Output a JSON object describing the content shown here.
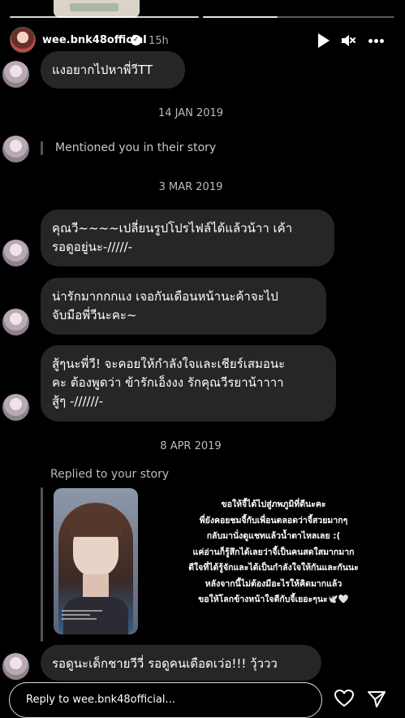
{
  "header": {
    "username": "wee.bnk48official",
    "time": "15h"
  },
  "messages": [
    {
      "text": "แงอยากไปหาพี่วีTT"
    },
    {
      "date": "14 JAN 2019"
    },
    {
      "mention": "Mentioned you in their story"
    },
    {
      "date": "3 MAR 2019"
    },
    {
      "text": "คุณวี~~~~เปลี่ยนรูปโปรไฟล์ได้แล้วน้าา เค้า\nรอดูอยู่นะ-/////-"
    },
    {
      "text": "น่ารักมากกกแง เจอกันเดือนหน้านะค้าจะไป\nจับมือพี่วีนะคะ~"
    },
    {
      "text": "สู้ๆนะพี่วี! จะคอยให้กำลังใจและเชียร์เสมอนะ\nคะ ต้องพูดว่า ข้ารักเอ็งงง รักคุณวีรยาน้าาาา\nสู้ๆ -//////-"
    },
    {
      "date": "8 APR 2019"
    },
    {
      "text": "รอดูนะเด็กชายวีวี่ รอดูคนเดือดเว่อ!!! วุ้ววว"
    }
  ],
  "story_reply": {
    "label": "Replied to your story",
    "text": "ขอให้จี้ได้ไปสู่ภพภูมิที่ดีนะคะ\nพี่ยังคอยชมจี้กับเพื่อนตลอดว่าจี้สวยมากๆ\nกลับมานั่งดูแชทแล้วน้ำตาไหลเลย :(\nแค่อ่านก็รู้สึกได้เลยว่าจี้เป็นคนสดใสมากมาก\nดีใจที่ได้รู้จักและได้เป็นกำลังใจให้กันและกันนะ\nหลังจากนี้ไม่ต้องมีอะไรให้คิดมากแล้ว\nขอให้โลกข้างหน้าใจดีกับจี้เยอะๆนะ🕊️🤍"
  },
  "reply_input": {
    "placeholder": "Reply to wee.bnk48official..."
  },
  "icons": {
    "header": [
      "play-icon",
      "mute-icon",
      "more-options-icon"
    ],
    "footer": [
      "heart-icon",
      "send-icon"
    ]
  }
}
